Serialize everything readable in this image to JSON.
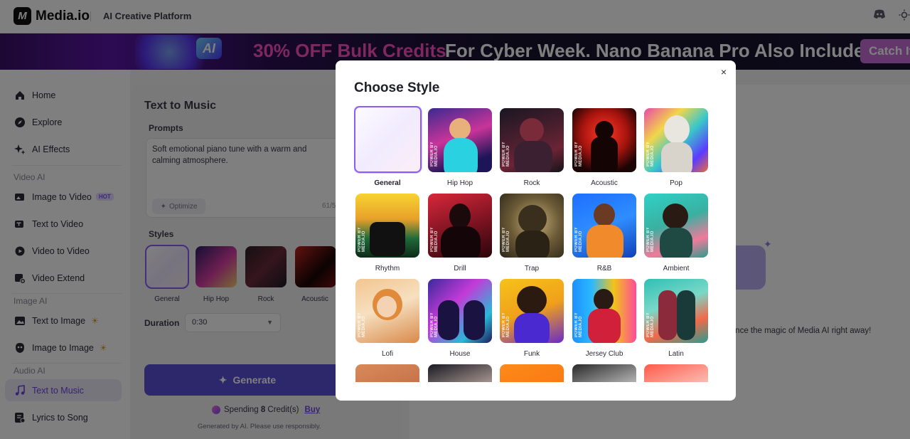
{
  "topbar": {
    "logo_mark": "M",
    "logo_text": "Media.io",
    "platform": "AI Creative Platform",
    "icons": [
      "discord-icon",
      "theme-sun-icon"
    ]
  },
  "banner": {
    "badge": "AI",
    "deal": "30% OFF Bulk Credits",
    "rest": "For Cyber Week. Nano Banana Pro Also Included!",
    "cta": "Catch It"
  },
  "sidebar": {
    "items": [
      {
        "label": "Home",
        "icon": "home-icon"
      },
      {
        "label": "Explore",
        "icon": "compass-icon"
      },
      {
        "label": "AI Effects",
        "icon": "sparkle-icon"
      },
      {
        "label": "Image to Video",
        "icon": "image-video-icon",
        "badge": "HOT"
      },
      {
        "label": "Text to Video",
        "icon": "text-video-icon"
      },
      {
        "label": "Video to Video",
        "icon": "video-video-icon"
      },
      {
        "label": "Video Extend",
        "icon": "video-extend-icon"
      },
      {
        "label": "Text to Image",
        "icon": "text-image-icon",
        "extra": "banana"
      },
      {
        "label": "Image to Image",
        "icon": "image-image-icon",
        "extra": "banana"
      },
      {
        "label": "Text to Music",
        "icon": "music-note-icon",
        "active": true
      },
      {
        "label": "Lyrics to Song",
        "icon": "lyrics-song-icon"
      }
    ],
    "sections": [
      "Video AI",
      "Image AI",
      "Audio AI"
    ]
  },
  "main": {
    "title": "Text to Music",
    "prompts_label": "Prompts",
    "prompt_text": "Soft emotional piano tune with a warm and calming atmosphere.",
    "optimize_label": "Optimize",
    "counter": "61/5",
    "styles_label": "Styles",
    "styles": [
      "General",
      "Hip Hop",
      "Rock",
      "Acoustic"
    ],
    "duration_label": "Duration",
    "duration_value": "0:30",
    "generate_label": "Generate",
    "spending_prefix": "Spending",
    "spending_amount": "8",
    "spending_suffix": "Credit(s)",
    "buy_label": "Buy",
    "disclaimer": "Generated by AI. Please use responsibly.",
    "magic_text": "erience the magic of Media AI right away!"
  },
  "modal": {
    "title": "Choose Style",
    "close": "×",
    "stamp": "POWER BY MEDIA.IO",
    "tiles": [
      {
        "label": "General",
        "selected": true
      },
      {
        "label": "Hip Hop"
      },
      {
        "label": "Rock"
      },
      {
        "label": "Acoustic"
      },
      {
        "label": "Pop"
      },
      {
        "label": "Rhythm"
      },
      {
        "label": "Drill"
      },
      {
        "label": "Trap"
      },
      {
        "label": "R&B"
      },
      {
        "label": "Ambient"
      },
      {
        "label": "Lofi"
      },
      {
        "label": "House"
      },
      {
        "label": "Funk"
      },
      {
        "label": "Jersey Club"
      },
      {
        "label": "Latin"
      }
    ]
  }
}
